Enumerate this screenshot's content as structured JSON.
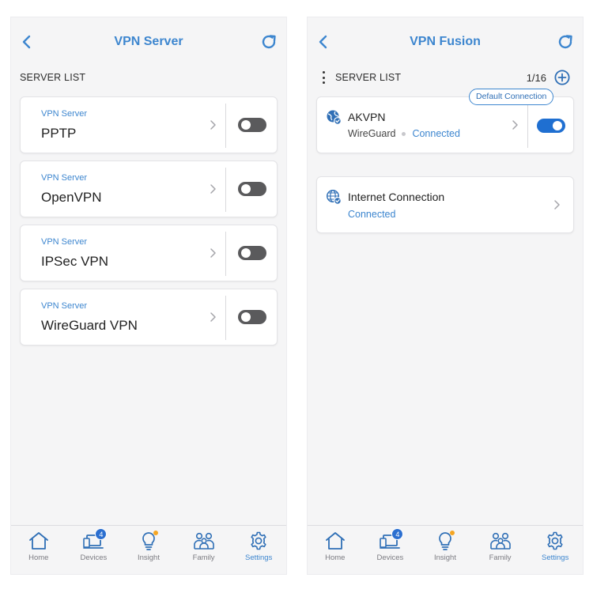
{
  "left": {
    "title": "VPN Server",
    "section_label": "SERVER LIST",
    "servers": [
      {
        "subtitle": "VPN Server",
        "name": "PPTP",
        "enabled": false
      },
      {
        "subtitle": "VPN Server",
        "name": "OpenVPN",
        "enabled": false
      },
      {
        "subtitle": "VPN Server",
        "name": "IPSec VPN",
        "enabled": false
      },
      {
        "subtitle": "VPN Server",
        "name": "WireGuard VPN",
        "enabled": false
      }
    ]
  },
  "right": {
    "title": "VPN Fusion",
    "section_label": "SERVER LIST",
    "count": "1/16",
    "default_badge": "Default Connection",
    "connections": [
      {
        "name": "AKVPN",
        "protocol": "WireGuard",
        "status": "Connected",
        "enabled": true
      },
      {
        "name": "Internet Connection",
        "status": "Connected"
      }
    ]
  },
  "tabbar": {
    "items": [
      {
        "label": "Home",
        "icon": "home-icon"
      },
      {
        "label": "Devices",
        "icon": "devices-icon",
        "badge": "4"
      },
      {
        "label": "Insight",
        "icon": "lightbulb-icon"
      },
      {
        "label": "Family",
        "icon": "family-icon"
      },
      {
        "label": "Settings",
        "icon": "gear-icon",
        "active": true
      }
    ]
  },
  "colors": {
    "accent": "#3d86cf",
    "toggle_on": "#1f6fd1",
    "toggle_off": "#5a5a5c",
    "notification_dot": "#f5a623",
    "badge": "#2b6fd0"
  }
}
